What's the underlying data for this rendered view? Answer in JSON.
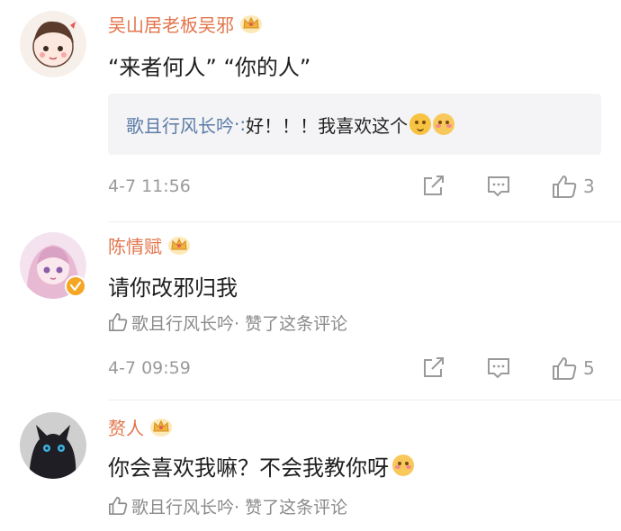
{
  "comments": [
    {
      "username": "吴山居老板吴邪",
      "text": "“来者何人”  “你的人”",
      "reply": {
        "user": "歌且行风长吟",
        "sep": "·:",
        "text": "好！！！我喜欢这个"
      },
      "time": "4-7 11:56",
      "likes": "3"
    },
    {
      "username": "陈情赋",
      "text": "请你改邪归我",
      "liked_by": "歌且行风长吟· 赞了这条评论",
      "time": "4-7 09:59",
      "likes": "5"
    },
    {
      "username": "赘人",
      "text": "你会喜欢我嘛？不会我教你呀",
      "liked_by": "歌且行风长吟· 赞了这条评论"
    }
  ],
  "icons": {
    "share": "share-icon",
    "comment": "comment-icon",
    "like": "thumbs-up-icon",
    "crown": "crown-badge-icon"
  },
  "colors": {
    "username": "#e2754b",
    "reply_user": "#5b7ba6",
    "meta": "#9a9a9a",
    "crown_gold": "#f0b43c",
    "verified_badge": "#f5a623"
  }
}
